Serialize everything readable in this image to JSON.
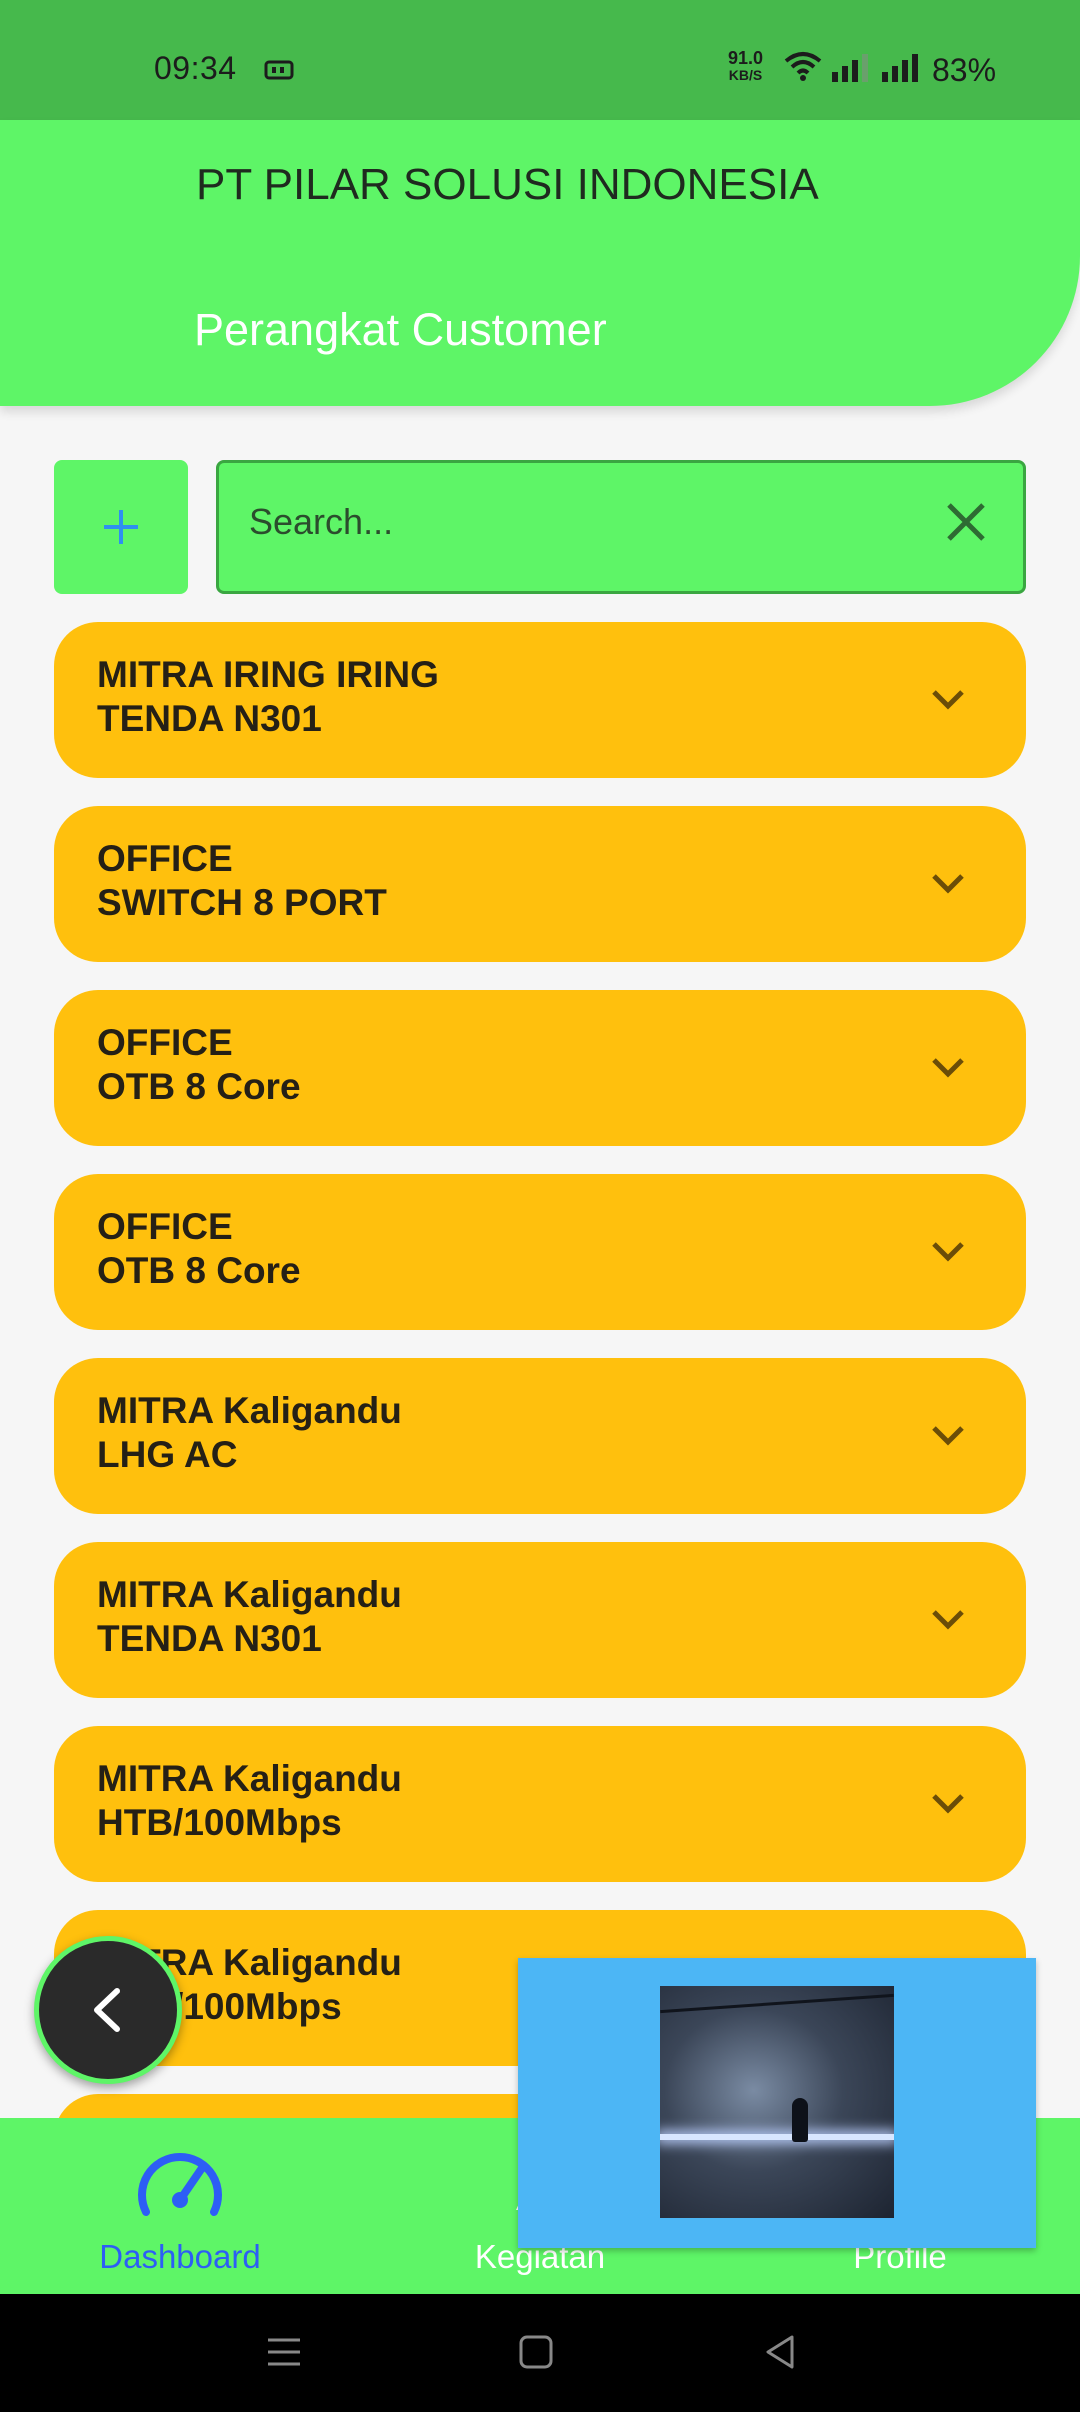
{
  "status_bar": {
    "time": "09:34",
    "net_speed_value": "91.0",
    "net_speed_unit": "KB/S",
    "battery": "83%"
  },
  "header": {
    "company": "PT PILAR SOLUSI INDONESIA",
    "title": "Perangkat Customer"
  },
  "toolbar": {
    "add_label": "+",
    "search_placeholder": "Search..."
  },
  "items": [
    {
      "line1": "MITRA IRING IRING",
      "line2": "TENDA N301"
    },
    {
      "line1": "OFFICE",
      "line2": "SWITCH 8 PORT"
    },
    {
      "line1": "OFFICE",
      "line2": "OTB 8 Core"
    },
    {
      "line1": "OFFICE",
      "line2": "OTB 8 Core"
    },
    {
      "line1": "MITRA Kaligandu",
      "line2": "LHG AC"
    },
    {
      "line1": "MITRA Kaligandu",
      "line2": "TENDA N301"
    },
    {
      "line1": "MITRA Kaligandu",
      "line2": "HTB/100Mbps"
    },
    {
      "line1": "MITRA Kaligandu",
      "line2": "HTB/100Mbps"
    }
  ],
  "bottom_nav": [
    {
      "label": "Dashboard",
      "icon": "speedometer-icon",
      "active": true
    },
    {
      "label": "Kegiatan",
      "icon": "activity-icon",
      "active": false
    },
    {
      "label": "Profile",
      "icon": "person-icon",
      "active": false
    }
  ],
  "colors": {
    "header_green": "#5ef567",
    "status_green": "#46b94c",
    "item_amber": "#ffc00d",
    "active_blue": "#2d5ef5",
    "pip_blue": "#4cb6f5"
  }
}
